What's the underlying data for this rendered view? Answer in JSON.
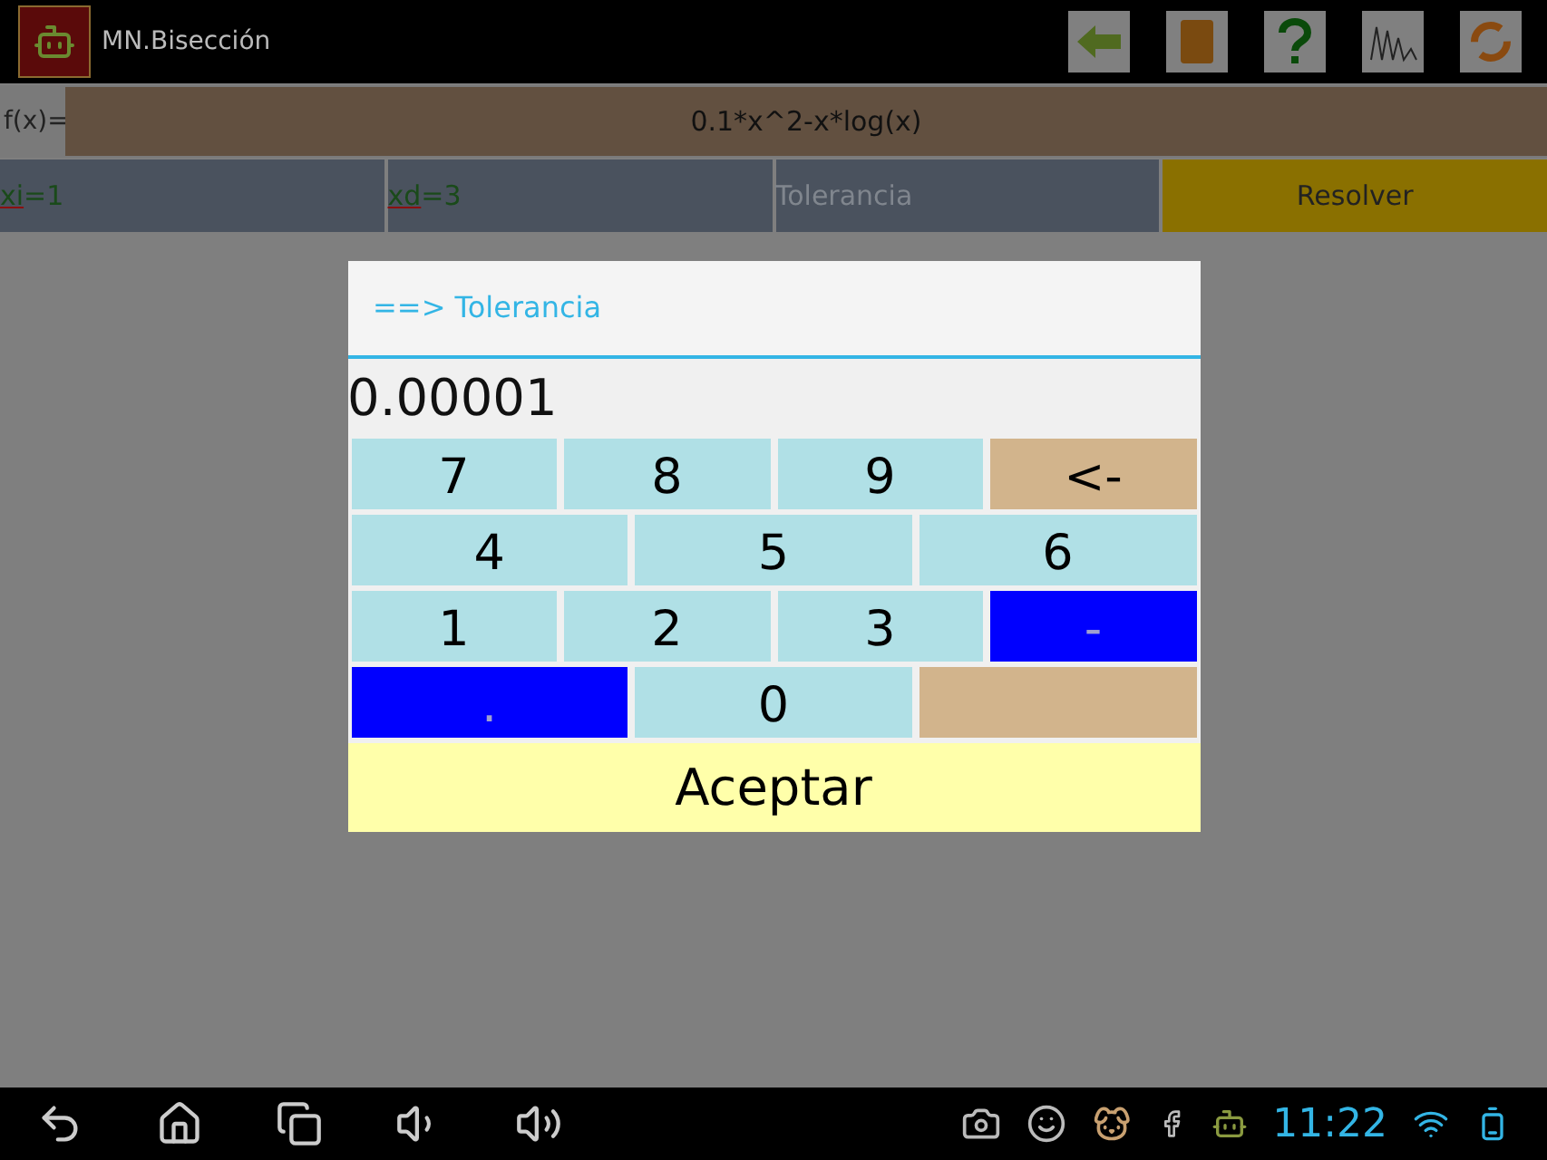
{
  "app_bar": {
    "title": "MN.Bisección"
  },
  "function_row": {
    "label": "f(x)=",
    "value": "0.1*x^2-x*log(x)"
  },
  "inputs": [
    {
      "kind": "value",
      "label": "xi",
      "value": "=1"
    },
    {
      "kind": "value",
      "label": "xd",
      "value": "=3"
    },
    {
      "kind": "hint",
      "placeholder": "Tolerancia"
    }
  ],
  "solve_button": "Resolver",
  "dialog": {
    "title": "==> Tolerancia",
    "value": "0.00001",
    "keypad": [
      [
        {
          "label": "7",
          "color": "#b0e0e6"
        },
        {
          "label": "8",
          "color": "#b0e0e6"
        },
        {
          "label": "9",
          "color": "#b0e0e6"
        },
        {
          "label": "<-",
          "color": "#d2b48c"
        }
      ],
      [
        {
          "label": "4",
          "color": "#b0e0e6"
        },
        {
          "label": "5",
          "color": "#b0e0e6"
        },
        {
          "label": "6",
          "color": "#b0e0e6"
        }
      ],
      [
        {
          "label": "1",
          "color": "#b0e0e6"
        },
        {
          "label": "2",
          "color": "#b0e0e6"
        },
        {
          "label": "3",
          "color": "#b0e0e6"
        },
        {
          "label": "-",
          "color": "#0000ff"
        }
      ],
      [
        {
          "label": ".",
          "color": "#0000ff"
        },
        {
          "label": "0",
          "color": "#b0e0e6"
        },
        {
          "color": "#d2b48c"
        }
      ]
    ],
    "accept": "Aceptar"
  },
  "status_bar": {
    "time": "11:22"
  }
}
